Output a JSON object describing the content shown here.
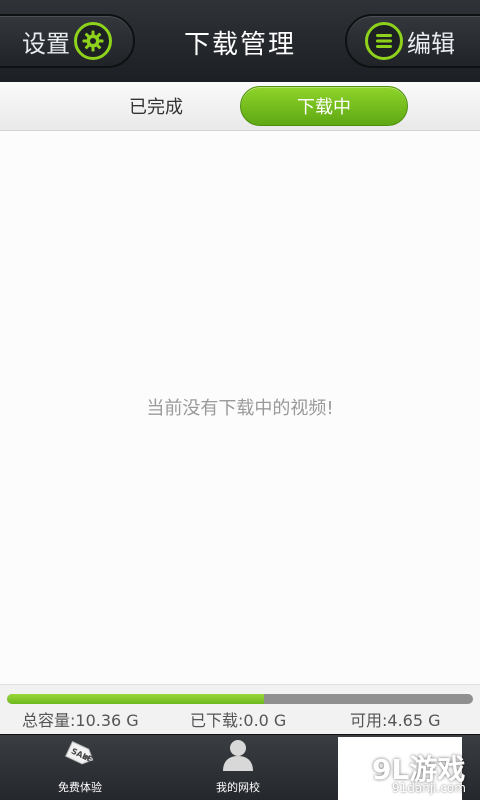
{
  "header": {
    "title": "下载管理",
    "settings_label": "设置",
    "edit_label": "编辑"
  },
  "tabs": [
    {
      "label": "已完成",
      "active": false
    },
    {
      "label": "下载中",
      "active": true
    }
  ],
  "empty_message": "当前没有下载中的视频!",
  "storage": {
    "total": "总容量:10.36 G",
    "downloaded": "已下载:0.0 G",
    "available": "可用:4.65 G",
    "used_fraction": 0.551
  },
  "bottom_nav": [
    {
      "label": "免费体验",
      "icon": "sale-tag-icon"
    },
    {
      "label": "我的网校",
      "icon": "user-icon"
    }
  ],
  "watermark": {
    "brand": "9L游戏",
    "site": "91danji.com"
  },
  "colors": {
    "accent_green": "#7cc41c",
    "header_dark": "#25282c"
  }
}
